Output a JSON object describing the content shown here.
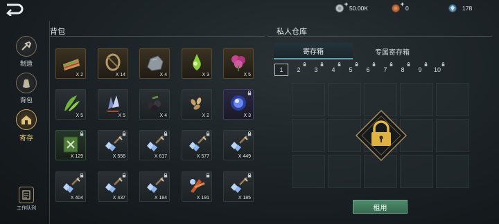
{
  "currencies": [
    {
      "icon": "silver-coin-icon",
      "value": "50.00K"
    },
    {
      "icon": "copper-coin-icon",
      "value": "0"
    },
    {
      "icon": "gem-icon",
      "value": "178"
    }
  ],
  "sidebar": {
    "items": [
      {
        "label": "制造",
        "icon": "crafting-icon"
      },
      {
        "label": "背包",
        "icon": "bag-icon"
      },
      {
        "label": "寄存",
        "icon": "storage-house-icon",
        "active": true
      }
    ],
    "work_queue": "工作队列"
  },
  "backpack": {
    "title": "背包",
    "items": [
      {
        "name": "sandwich-item-icon",
        "qty": "X 2",
        "rarity": "gold",
        "locked": false
      },
      {
        "name": "rope-item-icon",
        "qty": "X 14",
        "rarity": "gold",
        "locked": false
      },
      {
        "name": "stone-item-icon",
        "qty": "X 4",
        "rarity": "gold",
        "locked": false
      },
      {
        "name": "green-potion-item-icon",
        "qty": "X 3",
        "rarity": "gold",
        "locked": false
      },
      {
        "name": "purple-flower-item-icon",
        "qty": "X 5",
        "rarity": "gold",
        "locked": false
      },
      {
        "name": "herb-leaves-item-icon",
        "qty": "X 5",
        "rarity": "normal",
        "locked": false
      },
      {
        "name": "crystal-shard-item-icon",
        "qty": "X 5",
        "rarity": "normal",
        "locked": false
      },
      {
        "name": "berries-item-icon",
        "qty": "X 4",
        "rarity": "normal",
        "locked": false
      },
      {
        "name": "seeds-item-icon",
        "qty": "X 2",
        "rarity": "normal",
        "locked": false
      },
      {
        "name": "blue-orb-item-icon",
        "qty": "X 3",
        "rarity": "purple",
        "locked": true
      },
      {
        "name": "green-book-item-icon",
        "qty": "X 129",
        "rarity": "green",
        "locked": true
      },
      {
        "name": "blue-ore-dagger-item-icon",
        "qty": "X 556",
        "rarity": "normal",
        "locked": true
      },
      {
        "name": "blue-ore-sword-item-icon",
        "qty": "X 617",
        "rarity": "normal",
        "locked": true
      },
      {
        "name": "blue-ore-axe-item-icon",
        "qty": "X 577",
        "rarity": "normal",
        "locked": true
      },
      {
        "name": "blue-ore-hammer-item-icon",
        "qty": "X 449",
        "rarity": "normal",
        "locked": true
      },
      {
        "name": "blue-ore-blade-item-icon",
        "qty": "X 404",
        "rarity": "normal",
        "locked": true
      },
      {
        "name": "blue-ore-spear-item-icon",
        "qty": "X 437",
        "rarity": "normal",
        "locked": true
      },
      {
        "name": "blue-ore-staff-item-icon",
        "qty": "X 184",
        "rarity": "normal",
        "locked": true
      },
      {
        "name": "red-ore-item-icon",
        "qty": "X 191",
        "rarity": "normal",
        "locked": true
      },
      {
        "name": "blue-ore-mace-item-icon",
        "qty": "X 185",
        "rarity": "normal",
        "locked": true
      }
    ]
  },
  "warehouse": {
    "title": "私人仓库",
    "tabs": [
      "寄存箱",
      "专属寄存箱"
    ],
    "pages": [
      "1",
      "2",
      "3",
      "4",
      "5",
      "6",
      "7",
      "8",
      "9",
      "10"
    ],
    "rent_label": "租用"
  },
  "colors": {
    "accent_gold": "#c9a764",
    "tab_accent": "#5fa0ad",
    "rent_green": "#4c8a6a"
  }
}
